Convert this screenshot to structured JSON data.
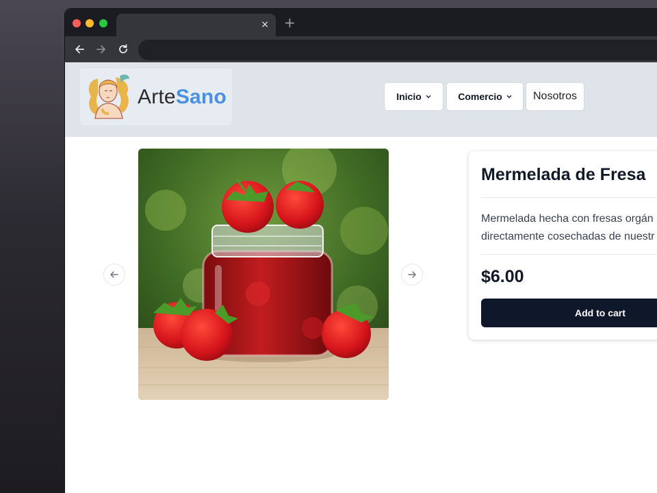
{
  "browser": {
    "tab_close": "×",
    "new_tab": "+",
    "url": ""
  },
  "header": {
    "logo_part1": "Arte",
    "logo_part2": "Sano",
    "nav": [
      {
        "label": "Inicio",
        "has_dropdown": true
      },
      {
        "label": "Comercio",
        "has_dropdown": true
      },
      {
        "label": "Nosotros",
        "has_dropdown": false
      }
    ]
  },
  "product": {
    "title": "Mermelada de Fresa",
    "description_line1": "Mermelada hecha con fresas orgán",
    "description_line2": "directamente cosechadas de nuestr",
    "price": "$6.00",
    "add_to_cart": "Add to cart"
  },
  "colors": {
    "accent": "#4a90e2",
    "button_dark": "#0f172a",
    "header_bg": "#dfe3ea"
  }
}
